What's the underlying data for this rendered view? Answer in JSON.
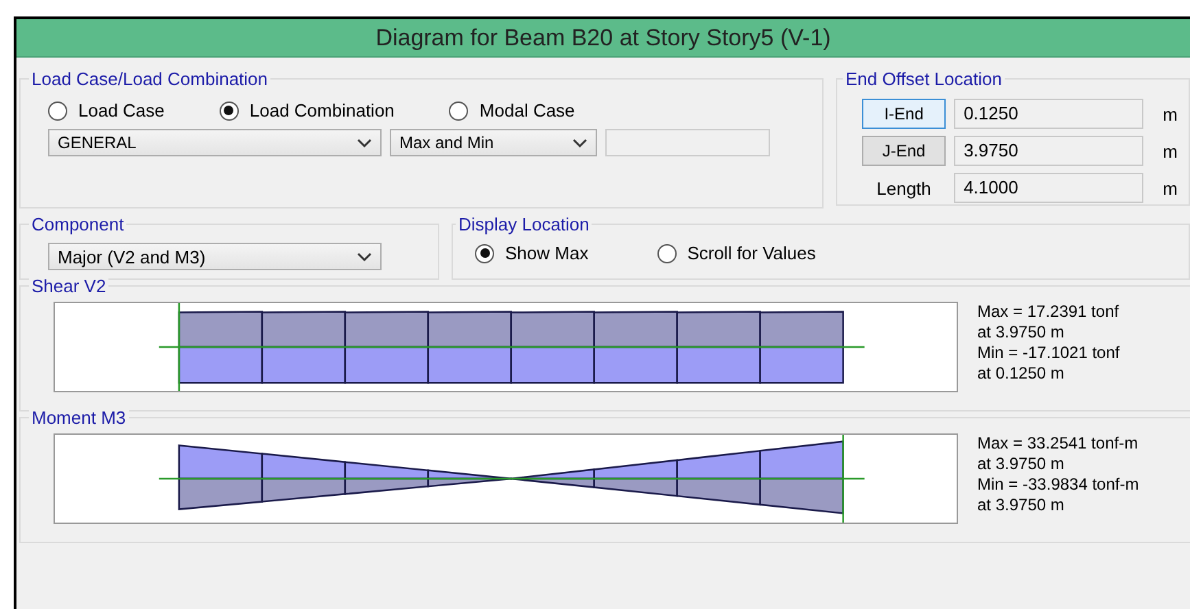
{
  "window": {
    "title": "Diagram for Beam B20 at Story Story5 (V-1)"
  },
  "load_case": {
    "legend": "Load Case/Load Combination",
    "options": [
      {
        "label": "Load Case",
        "selected": false
      },
      {
        "label": "Load Combination",
        "selected": true
      },
      {
        "label": "Modal Case",
        "selected": false
      }
    ],
    "dropdowns": [
      {
        "value": "GENERAL"
      },
      {
        "value": "Max and Min"
      }
    ]
  },
  "end_offset": {
    "legend": "End Offset Location",
    "rows": [
      {
        "kind": "button",
        "label": "I-End",
        "focused": true,
        "value": "0.1250",
        "unit": "m"
      },
      {
        "kind": "button",
        "label": "J-End",
        "focused": false,
        "value": "3.9750",
        "unit": "m"
      },
      {
        "kind": "label",
        "label": "Length",
        "value": "4.1000",
        "unit": "m"
      }
    ]
  },
  "component": {
    "legend": "Component",
    "value": "Major (V2 and M3)"
  },
  "display_location": {
    "legend": "Display Location",
    "options": [
      {
        "label": "Show Max",
        "selected": true
      },
      {
        "label": "Scroll for Values",
        "selected": false
      }
    ]
  },
  "panels": [
    {
      "title": "Shear V2",
      "kind": "shear",
      "results": [
        "Max = 17.2391 tonf",
        "at 3.9750 m",
        "Min = -17.1021 tonf",
        "at 0.1250 m"
      ]
    },
    {
      "title": "Moment M3",
      "kind": "moment",
      "results": [
        "Max = 33.2541 tonf-m",
        "at 3.9750 m",
        "Min = -33.9834 tonf-m",
        "at 3.9750 m"
      ]
    }
  ]
}
